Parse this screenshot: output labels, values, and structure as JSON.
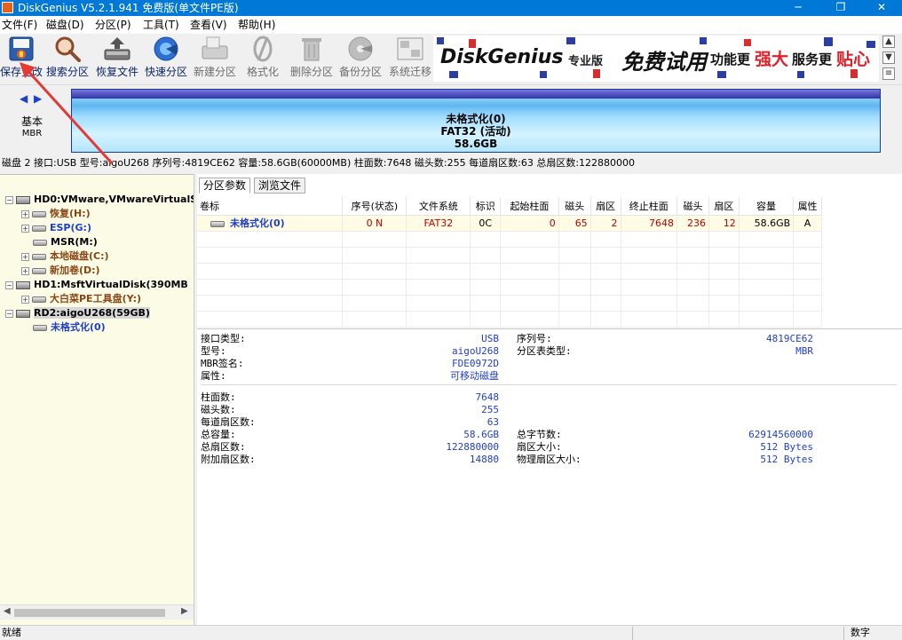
{
  "window": {
    "title": "DiskGenius V5.2.1.941 免费版(单文件PE版)",
    "min_glyph": "─",
    "max_glyph": "❐",
    "close_glyph": "✕"
  },
  "menu": [
    "文件(F)",
    "磁盘(D)",
    "分区(P)",
    "工具(T)",
    "查看(V)",
    "帮助(H)"
  ],
  "toolbar": [
    {
      "label": "保存更改",
      "icon": "save-changes-icon",
      "enabled": true
    },
    {
      "label": "搜索分区",
      "icon": "search-partition-icon",
      "enabled": true
    },
    {
      "label": "恢复文件",
      "icon": "recover-files-icon",
      "enabled": true
    },
    {
      "label": "快速分区",
      "icon": "quick-partition-icon",
      "enabled": true
    },
    {
      "label": "新建分区",
      "icon": "new-partition-icon",
      "enabled": false
    },
    {
      "label": "格式化",
      "icon": "format-icon",
      "enabled": false
    },
    {
      "label": "删除分区",
      "icon": "delete-partition-icon",
      "enabled": false
    },
    {
      "label": "备份分区",
      "icon": "backup-partition-icon",
      "enabled": false
    },
    {
      "label": "系统迁移",
      "icon": "system-migration-icon",
      "enabled": false
    }
  ],
  "banner": {
    "brand": "DiskGenius",
    "edition": "专业版",
    "promo1": "免费试用",
    "promo2": "功能更",
    "promo3": "强大",
    "promo4": "服务更",
    "promo5": "贴心"
  },
  "disk_panel": {
    "nav_prev": "◀",
    "nav_next": "▶",
    "disk_type": "基本",
    "partition_style": "MBR",
    "partition_name": "未格式化(0)",
    "partition_fs": "FAT32 (活动)",
    "partition_size": "58.6GB"
  },
  "disk_info": "磁盘 2 接口:USB  型号:aigoU268  序列号:4819CE62  容量:58.6GB(60000MB)  柱面数:7648  磁头数:255  每道扇区数:63  总扇区数:122880000",
  "tree": [
    {
      "label": "HD0:VMware,VMwareVirtualS",
      "indent": 0,
      "type": "disk",
      "expander": "−",
      "color": "black"
    },
    {
      "label": "恢复(H:)",
      "indent": 1,
      "type": "part",
      "expander": "+",
      "color": "brown"
    },
    {
      "label": "ESP(G:)",
      "indent": 1,
      "type": "part",
      "expander": "+",
      "color": "blue"
    },
    {
      "label": "MSR(M:)",
      "indent": 1,
      "type": "part",
      "expander": "",
      "color": "black"
    },
    {
      "label": "本地磁盘(C:)",
      "indent": 1,
      "type": "part",
      "expander": "+",
      "color": "brown"
    },
    {
      "label": "新加卷(D:)",
      "indent": 1,
      "type": "part",
      "expander": "+",
      "color": "brown"
    },
    {
      "label": "HD1:MsftVirtualDisk(390MB",
      "indent": 0,
      "type": "disk",
      "expander": "−",
      "color": "black"
    },
    {
      "label": "大白菜PE工具盘(Y:)",
      "indent": 1,
      "type": "part",
      "expander": "+",
      "color": "brown"
    },
    {
      "label": "RD2:aigoU268(59GB)",
      "indent": 0,
      "type": "disk",
      "expander": "−",
      "color": "black",
      "selected": true
    },
    {
      "label": "未格式化(0)",
      "indent": 1,
      "type": "part",
      "expander": "",
      "color": "blue"
    }
  ],
  "scroll": {
    "left": "◀",
    "right": "▶"
  },
  "tabs": [
    "分区参数",
    "浏览文件"
  ],
  "partition_table": {
    "headers": [
      "卷标",
      "序号(状态)",
      "文件系统",
      "标识",
      "起始柱面",
      "磁头",
      "扇区",
      "终止柱面",
      "磁头",
      "扇区",
      "容量",
      "属性"
    ],
    "rows": [
      [
        "未格式化(0)",
        "0 N",
        "FAT32",
        "0C",
        "0",
        "65",
        "2",
        "7648",
        "236",
        "12",
        "58.6GB",
        "A"
      ]
    ]
  },
  "details": {
    "group1_left": [
      {
        "k": "接口类型:",
        "v": "USB"
      },
      {
        "k": "型号:",
        "v": "aigoU268"
      },
      {
        "k": "MBR签名:",
        "v": "FDE0972D"
      },
      {
        "k": "属性:",
        "v": "可移动磁盘"
      }
    ],
    "group1_right": [
      {
        "k": "序列号:",
        "v": "4819CE62"
      },
      {
        "k": "分区表类型:",
        "v": "MBR"
      }
    ],
    "group2_left": [
      {
        "k": "柱面数:",
        "v": "7648"
      },
      {
        "k": "磁头数:",
        "v": "255"
      },
      {
        "k": "每道扇区数:",
        "v": "63"
      },
      {
        "k": "总容量:",
        "v": "58.6GB"
      },
      {
        "k": "总扇区数:",
        "v": "122880000"
      },
      {
        "k": "附加扇区数:",
        "v": "14880"
      }
    ],
    "group2_right": [
      {
        "k": "总字节数:",
        "v": "62914560000"
      },
      {
        "k": "扇区大小:",
        "v": "512 Bytes"
      },
      {
        "k": "物理扇区大小:",
        "v": "512 Bytes"
      }
    ]
  },
  "status": {
    "left": "就绪",
    "right": "数字"
  },
  "colors": {
    "titlebar": "#0078d7",
    "annotation_arrow": "#e53935",
    "link_blue": "#1f3fd0",
    "accent_red": "#c00000"
  }
}
